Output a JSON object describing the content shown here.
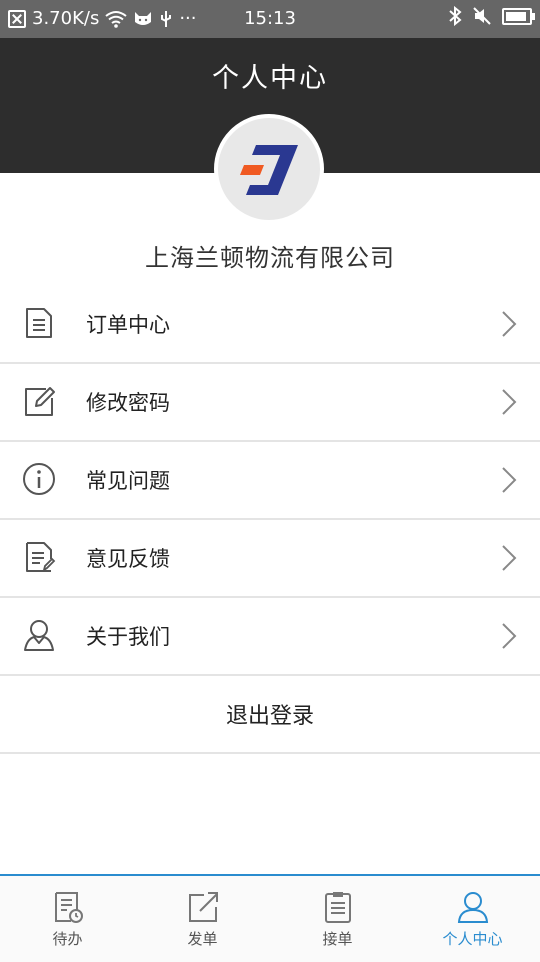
{
  "status_bar": {
    "speed": "3.70K/s",
    "dots": "···",
    "time": "15:13",
    "battery_fraction": 0.9
  },
  "header": {
    "title": "个人中心"
  },
  "profile": {
    "company_name": "上海兰顿物流有限公司",
    "logo_colors": {
      "blue": "#2a3891",
      "orange": "#f05a22"
    }
  },
  "menu": {
    "items": [
      {
        "label": "订单中心",
        "icon": "document-icon"
      },
      {
        "label": "修改密码",
        "icon": "edit-icon"
      },
      {
        "label": "常见问题",
        "icon": "info-icon"
      },
      {
        "label": "意见反馈",
        "icon": "feedback-icon"
      },
      {
        "label": "关于我们",
        "icon": "user-icon"
      }
    ],
    "logout_label": "退出登录"
  },
  "tabbar": {
    "tabs": [
      {
        "label": "待办",
        "icon": "todo-icon",
        "active": false
      },
      {
        "label": "发单",
        "icon": "send-order-icon",
        "active": false
      },
      {
        "label": "接单",
        "icon": "clipboard-icon",
        "active": false
      },
      {
        "label": "个人中心",
        "icon": "person-icon",
        "active": true
      }
    ]
  },
  "colors": {
    "header_bg": "#2d2d2d",
    "accent": "#2a8ccf",
    "divider": "#e4e4e4"
  }
}
